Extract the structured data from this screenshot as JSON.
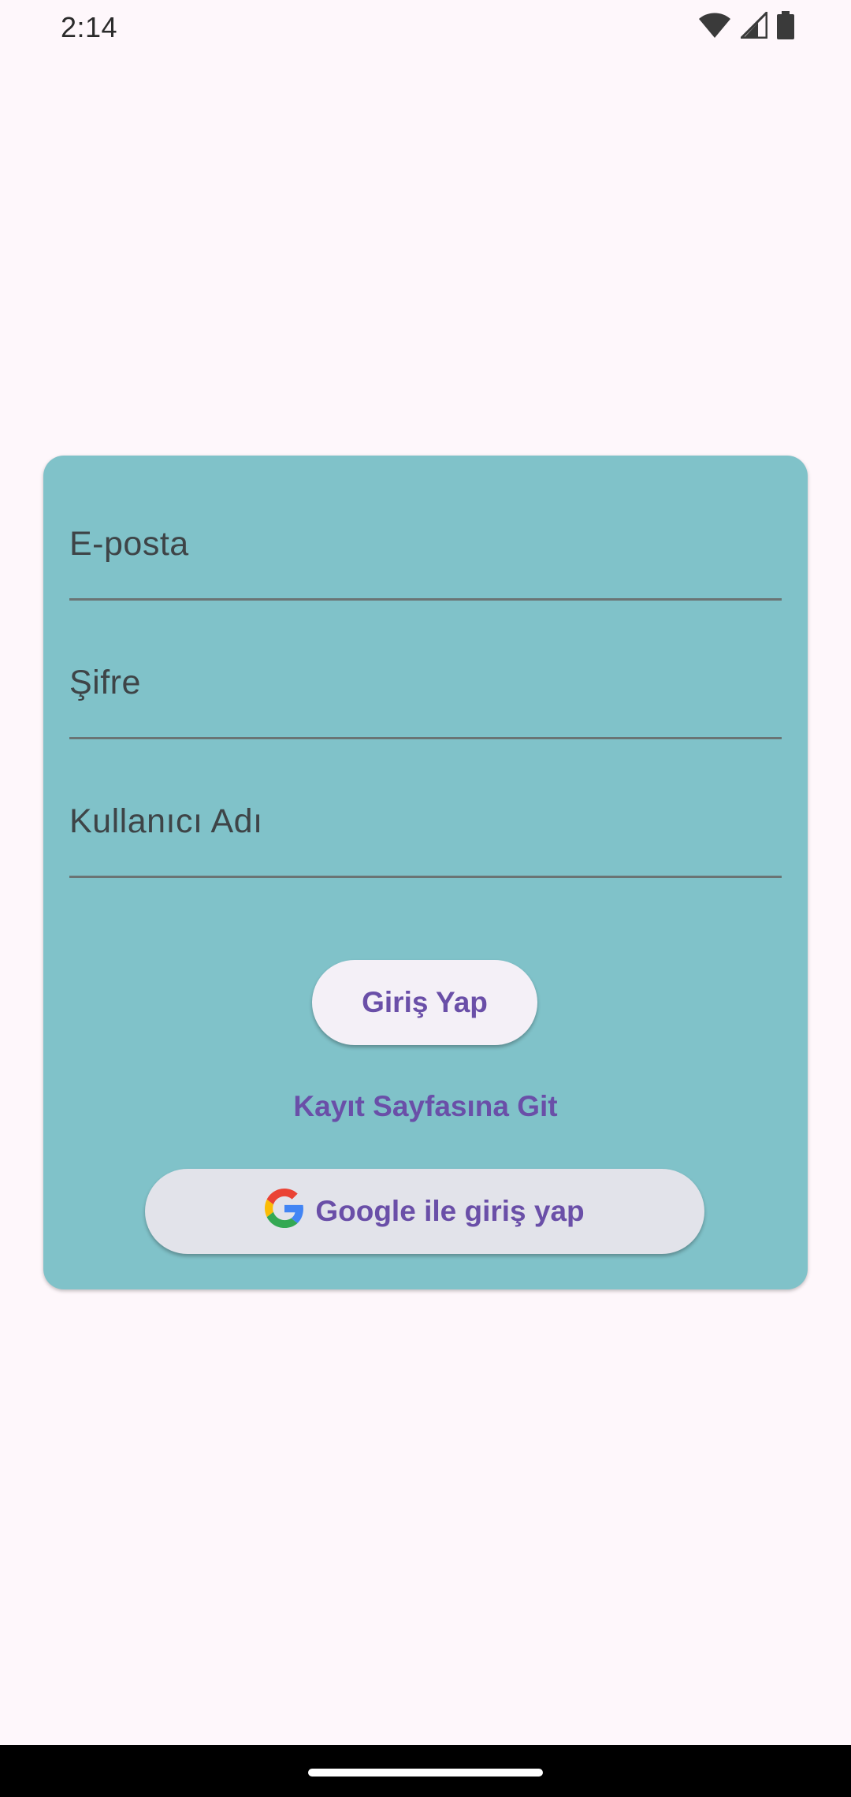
{
  "status_bar": {
    "time": "2:14"
  },
  "form": {
    "email_placeholder": "E-posta",
    "password_placeholder": "Şifre",
    "username_placeholder": "Kullanıcı Adı",
    "login_label": "Giriş Yap",
    "register_link": "Kayıt Sayfasına Git",
    "google_label": "Google ile giriş yap"
  },
  "colors": {
    "card_bg": "#80c2c9",
    "accent": "#6a4fa8",
    "page_bg": "#fef7fb"
  },
  "icons": {
    "wifi": "wifi-icon",
    "signal": "signal-icon",
    "battery": "battery-icon",
    "google": "google-logo-icon"
  }
}
